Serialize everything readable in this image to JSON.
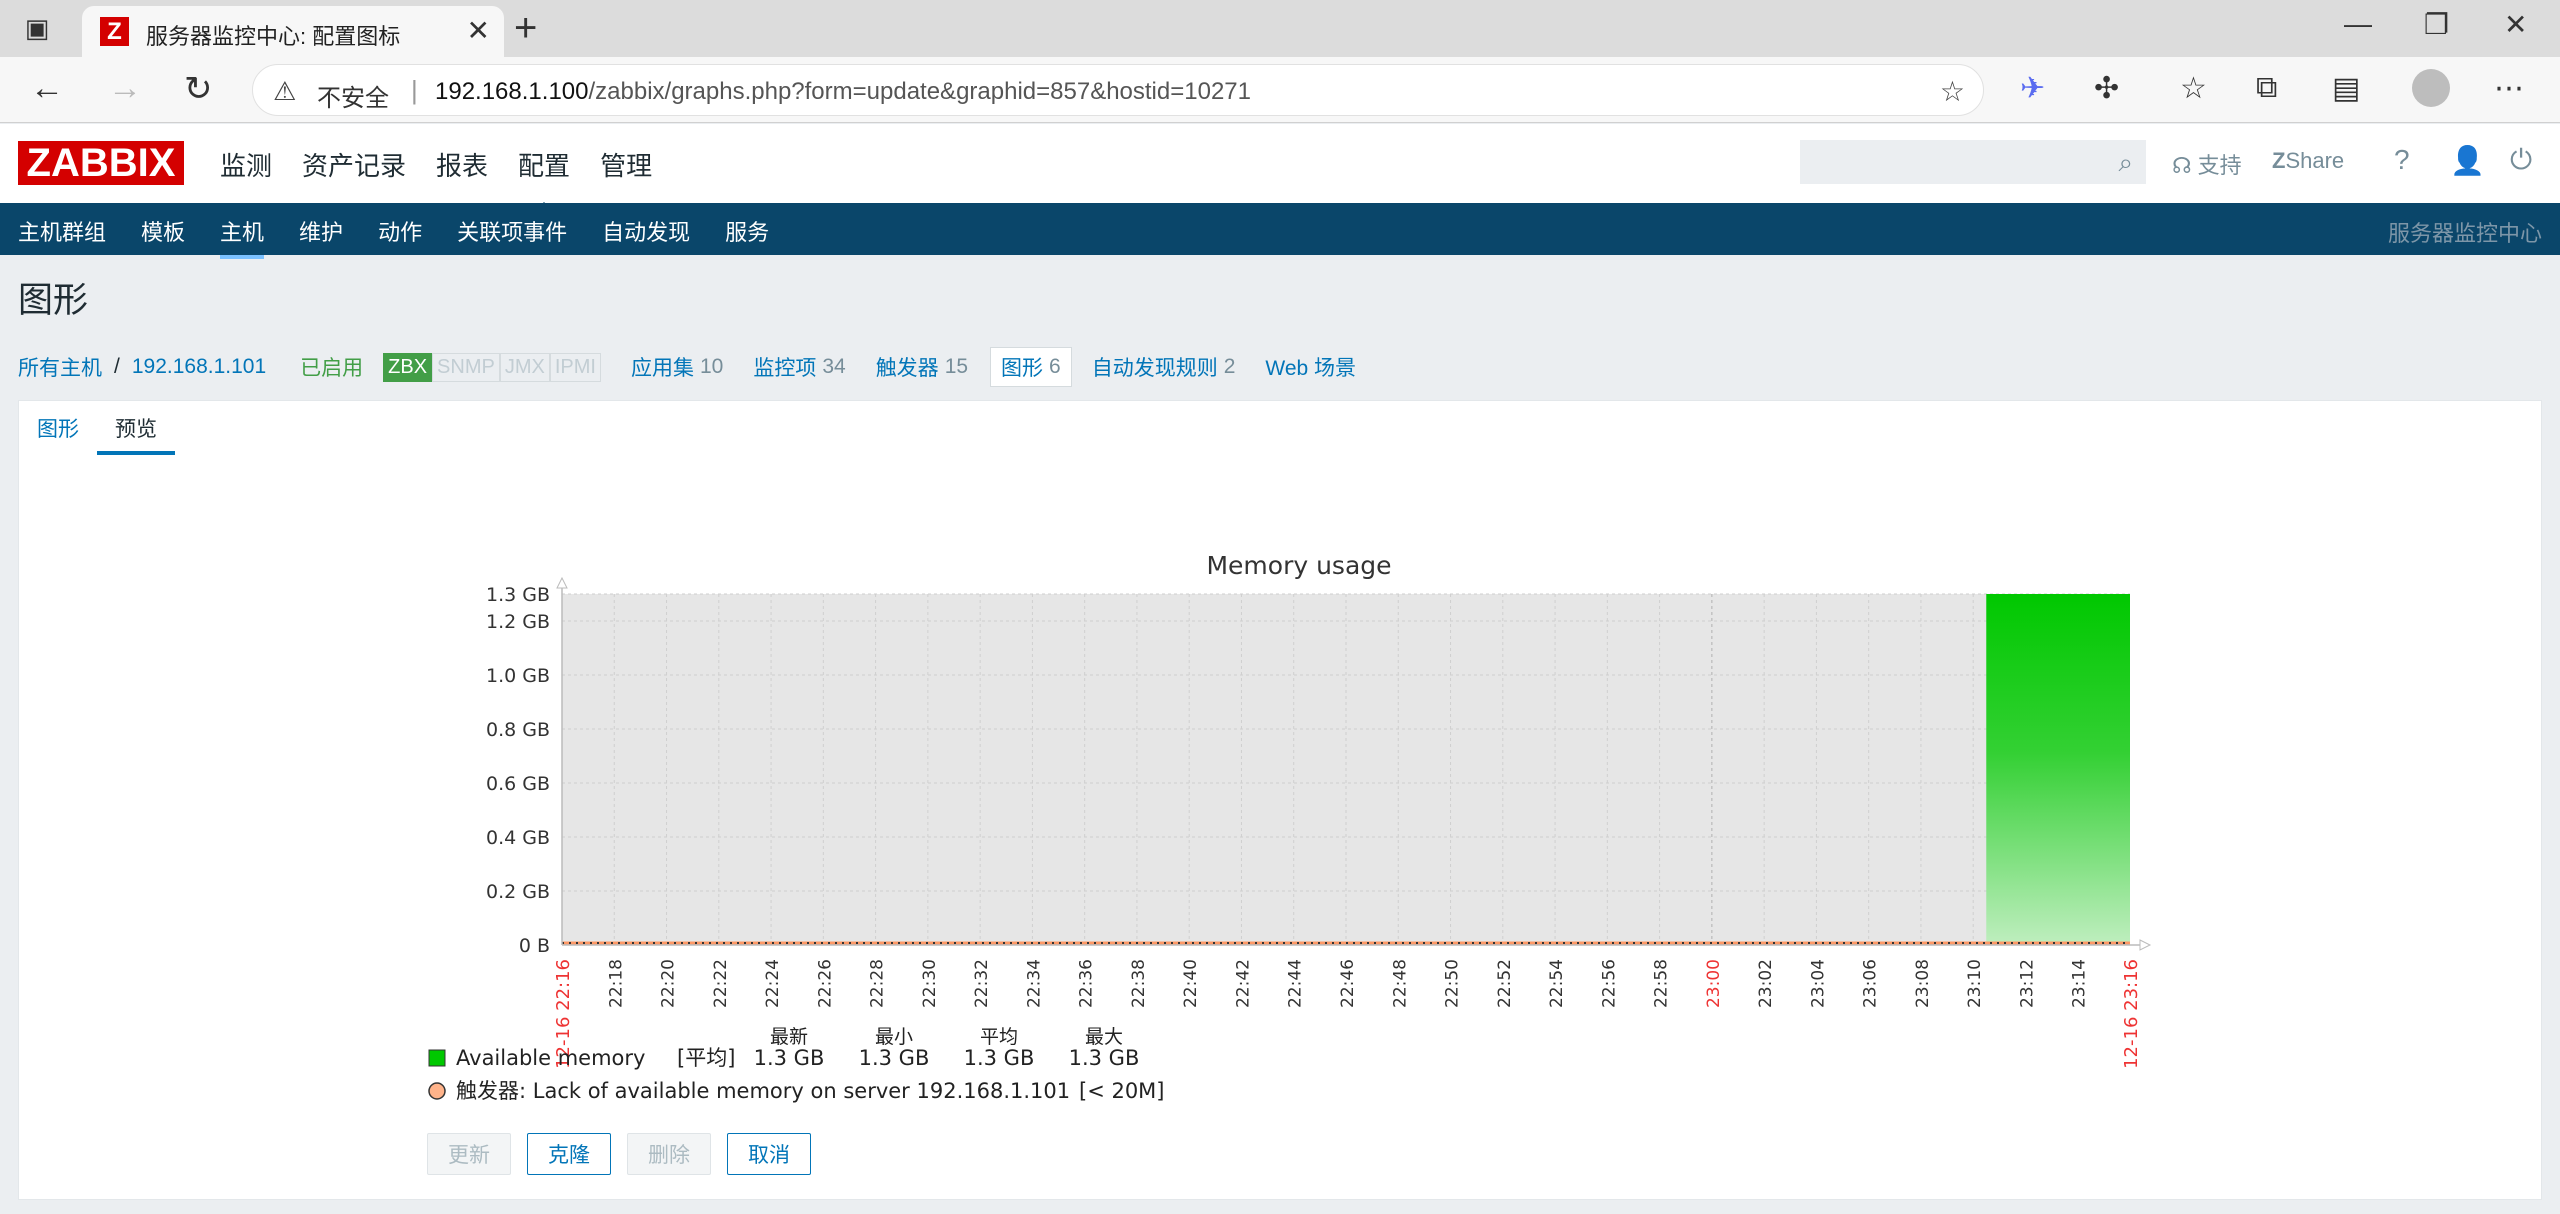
{
  "browser": {
    "tab_title": "服务器监控中心: 配置图标",
    "favicon_letter": "Z",
    "insecure_label": "不安全",
    "url_host": "192.168.1.100",
    "url_path": "/zabbix/graphs.php?form=update&graphid=857&hostid=10271"
  },
  "header": {
    "logo": "ZABBIX",
    "menu": [
      "监测",
      "资产记录",
      "报表",
      "配置",
      "管理"
    ],
    "active_menu": "配置",
    "support": "支持",
    "share": "Share",
    "help": "?"
  },
  "subnav": {
    "items": [
      "主机群组",
      "模板",
      "主机",
      "维护",
      "动作",
      "关联项事件",
      "自动发现",
      "服务"
    ],
    "active": "主机",
    "server_name": "服务器监控中心"
  },
  "page_title": "图形",
  "hostbar": {
    "all_hosts": "所有主机",
    "host": "192.168.1.101",
    "enabled": "已启用",
    "tags": [
      "ZBX",
      "SNMP",
      "JMX",
      "IPMI"
    ],
    "links": [
      {
        "label": "应用集",
        "count": "10"
      },
      {
        "label": "监控项",
        "count": "34"
      },
      {
        "label": "触发器",
        "count": "15"
      },
      {
        "label": "图形",
        "count": "6"
      },
      {
        "label": "自动发现规则",
        "count": "2"
      },
      {
        "label": "Web 场景",
        "count": ""
      }
    ]
  },
  "tabs": [
    "图形",
    "预览"
  ],
  "active_tab": "预览",
  "chart_data": {
    "type": "area",
    "title": "Memory usage",
    "y_ticks": [
      "1.3 GB",
      "1.2 GB",
      "1.0 GB",
      "0.8 GB",
      "0.6 GB",
      "0.4 GB",
      "0.2 GB",
      "0 B"
    ],
    "y_values": [
      1.3,
      1.2,
      1.0,
      0.8,
      0.6,
      0.4,
      0.2,
      0
    ],
    "ylim": [
      0,
      1.3
    ],
    "x_start_label": "12-16 22:16",
    "x_end_label": "12-16 23:16",
    "x_tick_labels": [
      "22:18",
      "22:20",
      "22:22",
      "22:24",
      "22:26",
      "22:28",
      "22:30",
      "22:32",
      "22:34",
      "22:36",
      "22:38",
      "22:40",
      "22:42",
      "22:44",
      "22:46",
      "22:48",
      "22:50",
      "22:52",
      "22:54",
      "22:56",
      "22:58",
      "23:00",
      "23:02",
      "23:04",
      "23:06",
      "23:08",
      "23:10",
      "23:12",
      "23:14"
    ],
    "x_range_minutes": [
      0,
      60
    ],
    "series": [
      {
        "name": "Available memory",
        "color": "#00c800",
        "data_start_minute": 54.5,
        "data_end_minute": 60,
        "value_gb": 1.3
      }
    ],
    "trigger": {
      "label": "触发器: Lack of available memory on server 192.168.1.101",
      "threshold": "[< 20M]",
      "color": "#ff9966"
    },
    "legend": {
      "rows": [
        {
          "name": "Available memory",
          "func": "[平均]",
          "values": [
            "1.3 GB",
            "1.3 GB",
            "1.3 GB",
            "1.3 GB"
          ]
        },
        {
          "name": "触发器: Lack of available memory on server 192.168.1.101",
          "threshold": "[< 20M]"
        }
      ],
      "headers": [
        "最新",
        "最小",
        "平均",
        "最大"
      ]
    }
  },
  "buttons": {
    "update": "更新",
    "clone": "克隆",
    "delete": "删除",
    "cancel": "取消"
  }
}
